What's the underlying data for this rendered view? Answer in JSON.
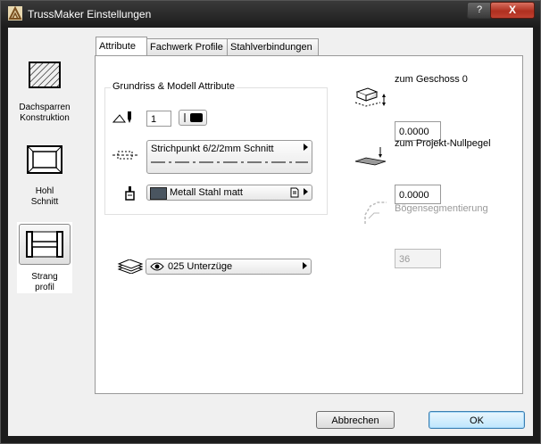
{
  "window": {
    "title": "TrussMaker Einstellungen",
    "help_label": "?",
    "close_label": "X"
  },
  "sidebar": {
    "items": [
      {
        "line1": "Dachsparren",
        "line2": "Konstruktion"
      },
      {
        "line1": "Hohl",
        "line2": "Schnitt"
      },
      {
        "line1": "Strang",
        "line2": "profil"
      }
    ]
  },
  "tabs": [
    "Attribute",
    "Fachwerk Profile",
    "Stahlverbindungen"
  ],
  "attributes": {
    "group_title": "Grundriss & Modell Attribute",
    "pen_value": "1",
    "line_type": "Strichpunkt 6/2/2mm Schnitt",
    "material": "Metall Stahl matt",
    "layer": "025 Unterzüge"
  },
  "right": {
    "story_label": "zum Geschoss 0",
    "story_value": "0.0000",
    "project_zero_label": "zum Projekt-Nullpegel",
    "project_zero_value": "0.0000",
    "arc_segmentation_label": "Bögensegmentierung",
    "arc_segmentation_value": "36"
  },
  "footer": {
    "cancel_label": "Abbrechen",
    "ok_label": "OK"
  },
  "colors": {
    "material_swatch": "#4a5560",
    "close_red": "#c0392b",
    "ok_border": "#3c7fb1"
  }
}
